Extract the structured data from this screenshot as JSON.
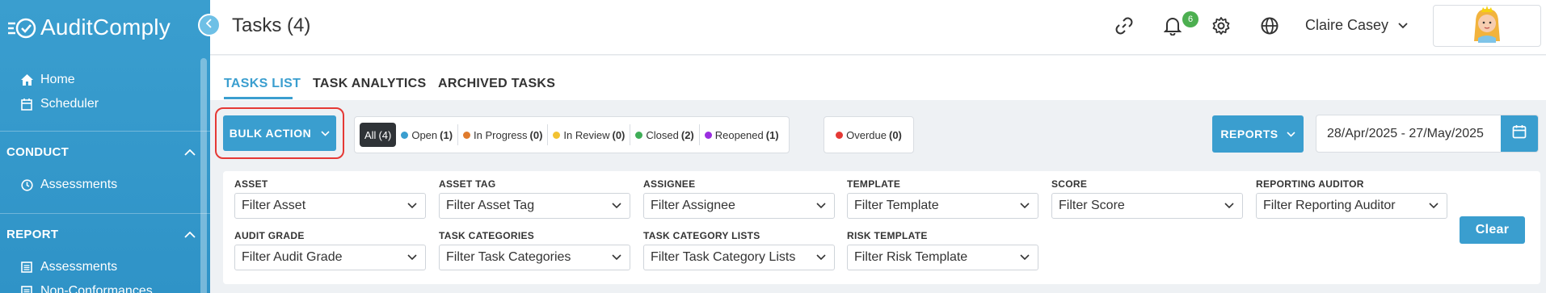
{
  "app": {
    "name": "AuditComply"
  },
  "sidebar": {
    "top_items": [
      {
        "label": "Home",
        "icon": "home-icon"
      },
      {
        "label": "Scheduler",
        "icon": "calendar-icon"
      }
    ],
    "sections": [
      {
        "title": "CONDUCT",
        "items": [
          {
            "label": "Assessments",
            "icon": "clock-icon"
          }
        ]
      },
      {
        "title": "REPORT",
        "items": [
          {
            "label": "Assessments",
            "icon": "list-icon"
          },
          {
            "label": "Non-Conformances",
            "icon": "list-icon"
          }
        ]
      }
    ]
  },
  "header": {
    "title": "Tasks (4)",
    "notification_count": "6",
    "user_name": "Claire Casey"
  },
  "tabs": [
    {
      "label": "TASKS LIST",
      "active": true
    },
    {
      "label": "TASK ANALYTICS",
      "active": false
    },
    {
      "label": "ARCHIVED TASKS",
      "active": false
    }
  ],
  "toolbar": {
    "bulk_action_label": "BULK ACTION",
    "statuses": [
      {
        "label": "All",
        "count": "(4)",
        "color": "",
        "active": true
      },
      {
        "label": "Open",
        "count": "(1)",
        "color": "#3a9ecf",
        "active": false
      },
      {
        "label": "In Progress",
        "count": "(0)",
        "color": "#e07b2d",
        "active": false
      },
      {
        "label": "In Review",
        "count": "(0)",
        "color": "#f2c232",
        "active": false
      },
      {
        "label": "Closed",
        "count": "(2)",
        "color": "#3fae57",
        "active": false
      },
      {
        "label": "Reopened",
        "count": "(1)",
        "color": "#9b2ee0",
        "active": false
      }
    ],
    "overdue": {
      "label": "Overdue",
      "count": "(0)",
      "color": "#e53935"
    },
    "reports_label": "REPORTS",
    "date_range": "28/Apr/2025 - 27/May/2025"
  },
  "filters": {
    "row1": [
      {
        "label": "ASSET",
        "placeholder": "Filter Asset"
      },
      {
        "label": "ASSET TAG",
        "placeholder": "Filter Asset Tag"
      },
      {
        "label": "ASSIGNEE",
        "placeholder": "Filter Assignee"
      },
      {
        "label": "TEMPLATE",
        "placeholder": "Filter Template"
      },
      {
        "label": "SCORE",
        "placeholder": "Filter Score"
      },
      {
        "label": "REPORTING AUDITOR",
        "placeholder": "Filter Reporting Auditor"
      }
    ],
    "row2": [
      {
        "label": "AUDIT GRADE",
        "placeholder": "Filter Audit Grade"
      },
      {
        "label": "TASK CATEGORIES",
        "placeholder": "Filter Task Categories"
      },
      {
        "label": "TASK CATEGORY LISTS",
        "placeholder": "Filter Task Category Lists"
      },
      {
        "label": "RISK TEMPLATE",
        "placeholder": "Filter Risk Template"
      }
    ],
    "clear_label": "Clear"
  },
  "colors": {
    "accent": "#3a9ecf",
    "highlight": "#e53935",
    "badge": "#4caf50"
  }
}
